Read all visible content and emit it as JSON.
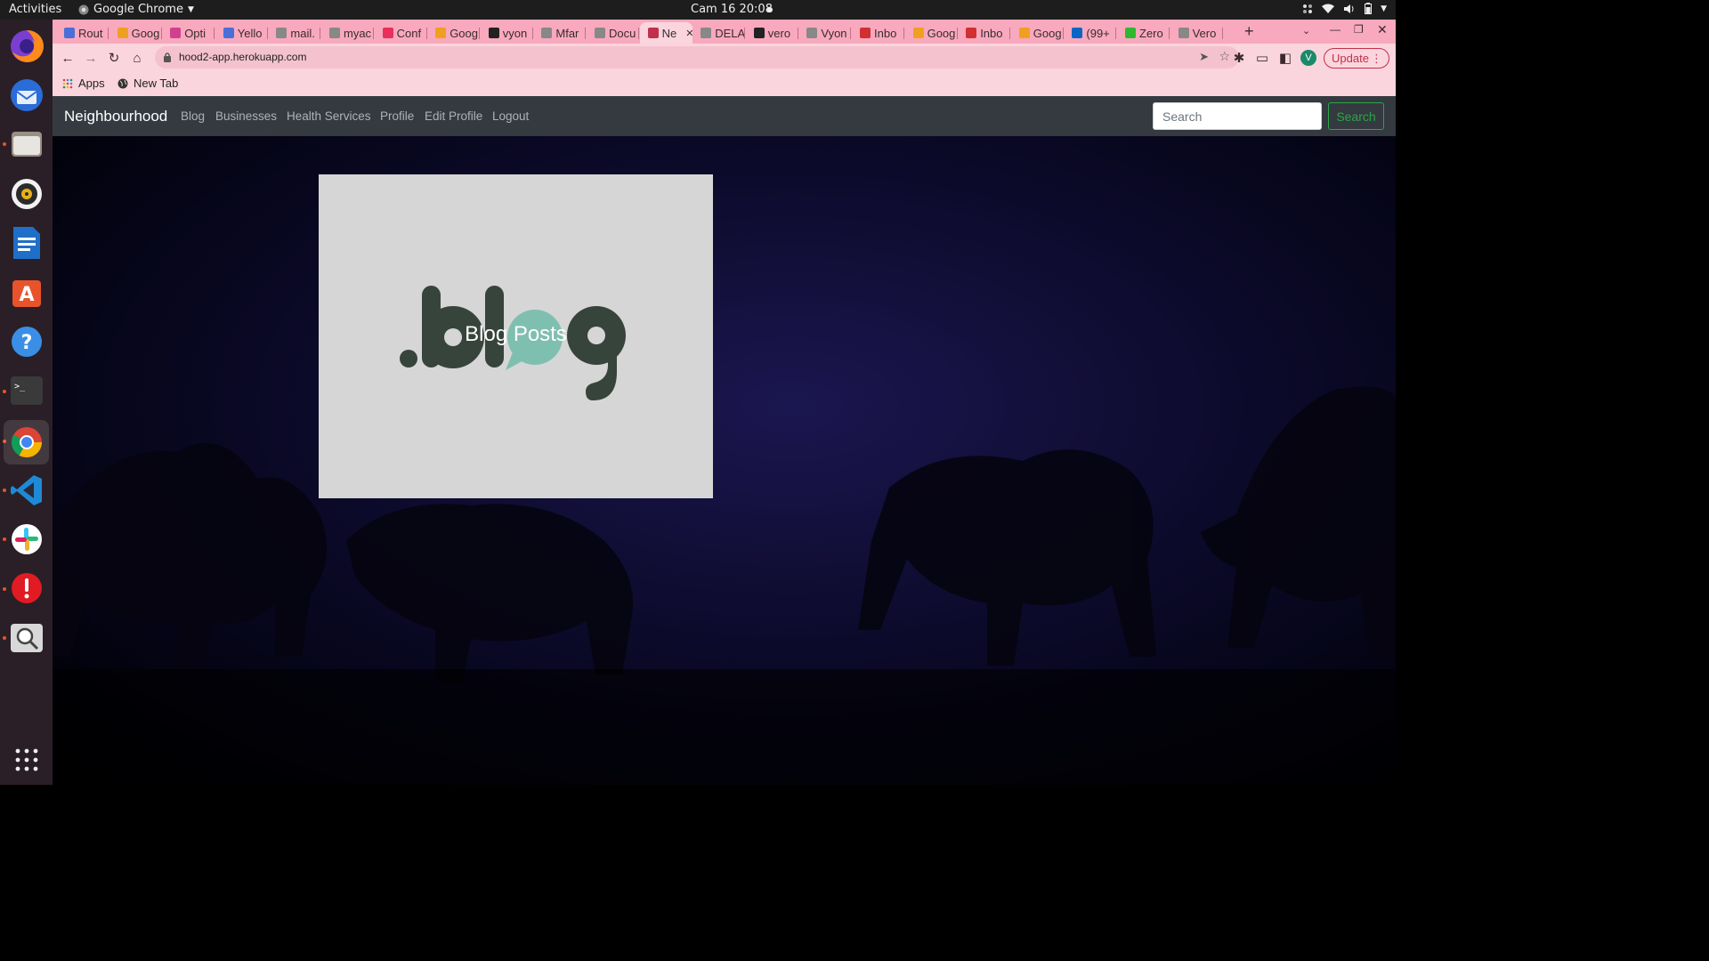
{
  "system": {
    "activities": "Activities",
    "app_name": "Google Chrome",
    "clock": "Cam 16  20:08"
  },
  "browser": {
    "tabs": [
      {
        "label": "Rout",
        "color": "#4a6fd8"
      },
      {
        "label": "Goog",
        "color": "#f0a020"
      },
      {
        "label": "Opti",
        "color": "#d04090"
      },
      {
        "label": "Yello",
        "color": "#4a6fd8"
      },
      {
        "label": "mail.",
        "color": "#888888"
      },
      {
        "label": "myac",
        "color": "#888888"
      },
      {
        "label": "Conf",
        "color": "#e8305a"
      },
      {
        "label": "Goog",
        "color": "#f0a020"
      },
      {
        "label": "vyon",
        "color": "#222222"
      },
      {
        "label": "Mfar",
        "color": "#888888"
      },
      {
        "label": "Docu",
        "color": "#888888"
      },
      {
        "label": "Ne",
        "color": "#c0304a",
        "active": true
      },
      {
        "label": "DELA",
        "color": "#888888"
      },
      {
        "label": "vero",
        "color": "#222222"
      },
      {
        "label": "Vyon",
        "color": "#888888"
      },
      {
        "label": "Inbo",
        "color": "#d03030"
      },
      {
        "label": "Goog",
        "color": "#f0a020"
      },
      {
        "label": "Inbo",
        "color": "#d03030"
      },
      {
        "label": "Goog",
        "color": "#f0a020"
      },
      {
        "label": "(99+",
        "color": "#0a66c2"
      },
      {
        "label": "Zero",
        "color": "#2eb82e"
      },
      {
        "label": "Vero",
        "color": "#888888"
      }
    ],
    "url": "hood2-app.herokuapp.com",
    "update_label": "Update",
    "profile_initial": "V",
    "bookmarks": {
      "apps": "Apps",
      "new_tab": "New Tab"
    }
  },
  "site": {
    "brand": "Neighbourhood",
    "nav": [
      "Blog",
      "Businesses",
      "Health Services",
      "Profile",
      "Edit Profile",
      "Logout"
    ],
    "search_placeholder": "Search",
    "search_button": "Search",
    "card": {
      "logo_text": ".blog",
      "overlay_title": "Blog Posts"
    }
  },
  "colors": {
    "navbar": "#343a40",
    "success": "#28a745",
    "tab_strip": "#f8a9bd",
    "toolbar": "#fbd5de",
    "blog_dark": "#37443c",
    "blog_bubble": "#7fbfb0"
  },
  "dock_apps": [
    "firefox-icon",
    "thunderbird-icon",
    "files-icon",
    "rhythmbox-icon",
    "writer-icon",
    "software-center-icon",
    "help-icon",
    "terminal-icon",
    "chrome-icon",
    "vscode-icon",
    "slack-icon",
    "update-alert-icon",
    "magnifier-icon",
    "app-grid-icon"
  ]
}
